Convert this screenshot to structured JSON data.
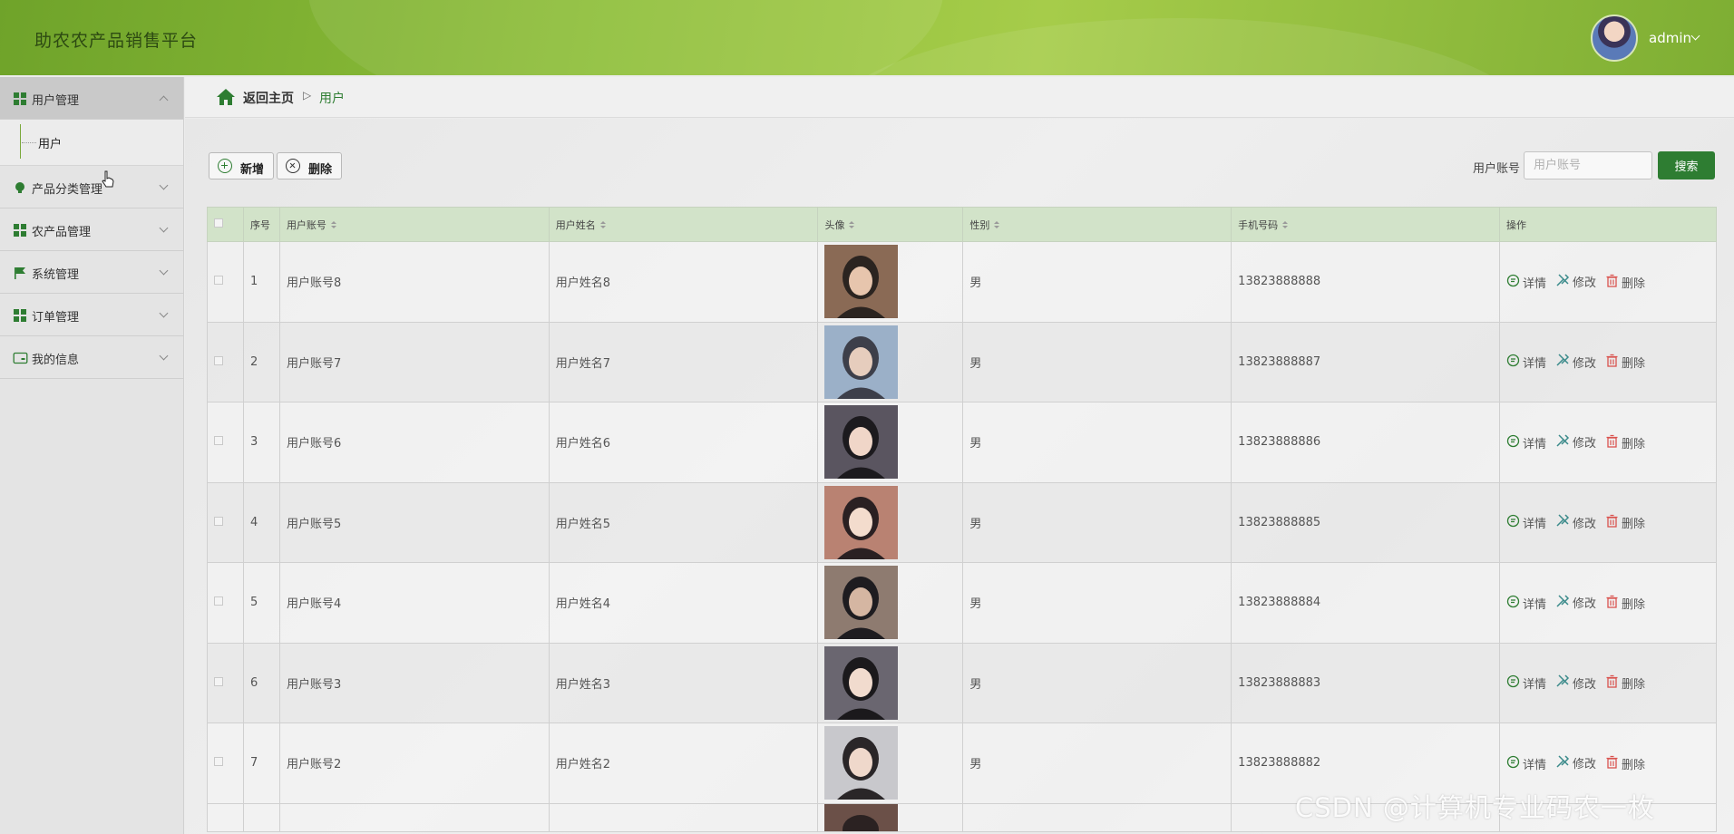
{
  "header": {
    "title": "助农农产品销售平台",
    "user": "admin"
  },
  "sidebar": {
    "items": [
      {
        "label": "用户管理",
        "active": true,
        "children": [
          {
            "label": "用户"
          }
        ]
      },
      {
        "label": "产品分类管理"
      },
      {
        "label": "农产品管理"
      },
      {
        "label": "系统管理"
      },
      {
        "label": "订单管理"
      },
      {
        "label": "我的信息"
      }
    ]
  },
  "breadcrumb": {
    "home": "返回主页",
    "separator": "▷",
    "current": "用户"
  },
  "toolbar": {
    "add_label": "新增",
    "delete_label": "删除"
  },
  "search": {
    "label": "用户账号",
    "placeholder": "用户账号",
    "button": "搜索"
  },
  "table": {
    "headers": [
      "序号",
      "用户账号",
      "用户姓名",
      "头像",
      "性别",
      "手机号码",
      "操作"
    ],
    "rows": [
      {
        "index": "1",
        "account": "用户账号8",
        "name": "用户姓名8",
        "gender": "男",
        "phone": "13823888888"
      },
      {
        "index": "2",
        "account": "用户账号7",
        "name": "用户姓名7",
        "gender": "男",
        "phone": "13823888887"
      },
      {
        "index": "3",
        "account": "用户账号6",
        "name": "用户姓名6",
        "gender": "男",
        "phone": "13823888886"
      },
      {
        "index": "4",
        "account": "用户账号5",
        "name": "用户姓名5",
        "gender": "男",
        "phone": "13823888885"
      },
      {
        "index": "5",
        "account": "用户账号4",
        "name": "用户姓名4",
        "gender": "男",
        "phone": "13823888884"
      },
      {
        "index": "6",
        "account": "用户账号3",
        "name": "用户姓名3",
        "gender": "男",
        "phone": "13823888883"
      },
      {
        "index": "7",
        "account": "用户账号2",
        "name": "用户姓名2",
        "gender": "男",
        "phone": "13823888882"
      }
    ],
    "actions": {
      "detail": "详情",
      "edit": "修改",
      "delete": "删除"
    }
  },
  "watermark": "CSDN @计算机专业码农一枚",
  "colors": {
    "primary": "#2e7d32",
    "header": "#8fbf3a",
    "table_header": "#d2e3c9",
    "delete": "#d9534f"
  }
}
